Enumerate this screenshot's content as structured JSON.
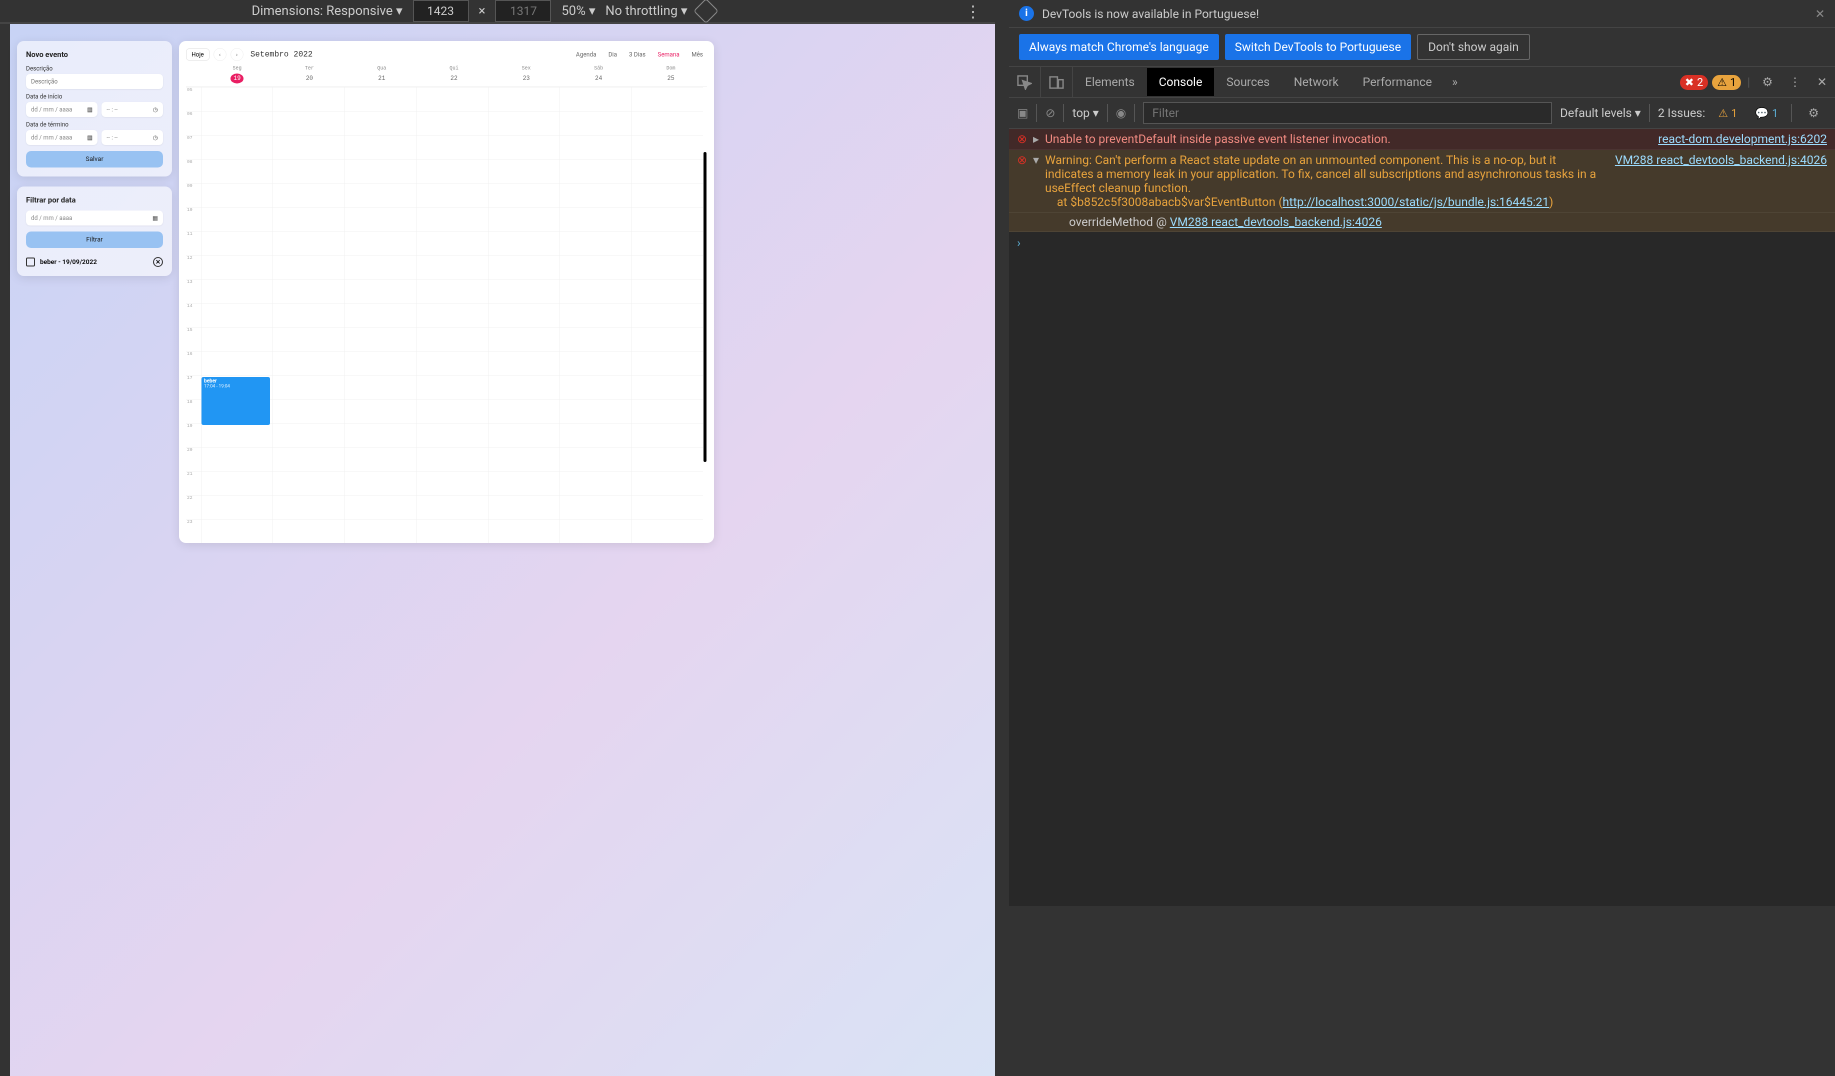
{
  "deviceToolbar": {
    "dimensionsLabel": "Dimensions: Responsive",
    "width": "1423",
    "height": "1317",
    "zoom": "50%",
    "throttling": "No throttling"
  },
  "app": {
    "newEvent": {
      "title": "Novo evento",
      "descLabel": "Descrição",
      "descPlaceholder": "Descrição",
      "startLabel": "Data de início",
      "endLabel": "Data de término",
      "datePlaceholder": "dd / mm / aaaa",
      "timePlaceholder": "-- : --",
      "saveLabel": "Salvar"
    },
    "filter": {
      "title": "Filtrar por data",
      "datePlaceholder": "dd / mm / aaaa",
      "filterLabel": "Filtrar"
    },
    "eventItem": {
      "text": "beber - 19/09/2022"
    },
    "calendar": {
      "todayLabel": "Hoje",
      "monthTitle": "Setembro 2022",
      "views": {
        "agenda": "Agenda",
        "dia": "Dia",
        "tresDias": "3 Dias",
        "semana": "Semana",
        "mes": "Mês"
      },
      "days": [
        {
          "name": "Seg",
          "num": "19",
          "today": true
        },
        {
          "name": "Ter",
          "num": "20",
          "today": false
        },
        {
          "name": "Qua",
          "num": "21",
          "today": false
        },
        {
          "name": "Qui",
          "num": "22",
          "today": false
        },
        {
          "name": "Sex",
          "num": "23",
          "today": false
        },
        {
          "name": "Sáb",
          "num": "24",
          "today": false
        },
        {
          "name": "Dom",
          "num": "25",
          "today": false
        }
      ],
      "hours": [
        "05",
        "06",
        "07",
        "08",
        "09",
        "10",
        "11",
        "12",
        "13",
        "14",
        "15",
        "16",
        "17",
        "18",
        "19",
        "20",
        "21",
        "22",
        "23"
      ],
      "event": {
        "title": "beber",
        "time": "17:04 - 19:04"
      }
    }
  },
  "devtools": {
    "infobarText": "DevTools is now available in Portuguese!",
    "langMatch": "Always match Chrome's language",
    "langSwitch": "Switch DevTools to Portuguese",
    "langDismiss": "Don't show again",
    "tabs": {
      "elements": "Elements",
      "console": "Console",
      "sources": "Sources",
      "network": "Network",
      "performance": "Performance"
    },
    "errorCount": "2",
    "warnCount": "1",
    "consoleToolbar": {
      "context": "top",
      "filterPlaceholder": "Filter",
      "levels": "Default levels",
      "issuesLabel": "2 Issues:",
      "issuesWarn": "1",
      "issuesInfo": "1"
    },
    "logs": {
      "err1": {
        "msg": "Unable to preventDefault inside passive event listener invocation.",
        "src": "react-dom.development.js:6202"
      },
      "warn1": {
        "msg": "Warning: Can't perform a React state update on an unmounted component. This is a no-op, but it indicates a memory leak in your application. To fix, cancel all subscriptions and asynchronous tasks in a useEffect cleanup function.\n    at $b852c5f3008abacb$var$EventButton (",
        "link": "http://localhost:3000/static/js/bundle.js:16445:21",
        "tail": ")",
        "src": "VM288 react_devtools_backend.js:4026"
      },
      "stack": {
        "method": "overrideMethod @ ",
        "link": "VM288 react_devtools_backend.js:4026"
      }
    }
  }
}
